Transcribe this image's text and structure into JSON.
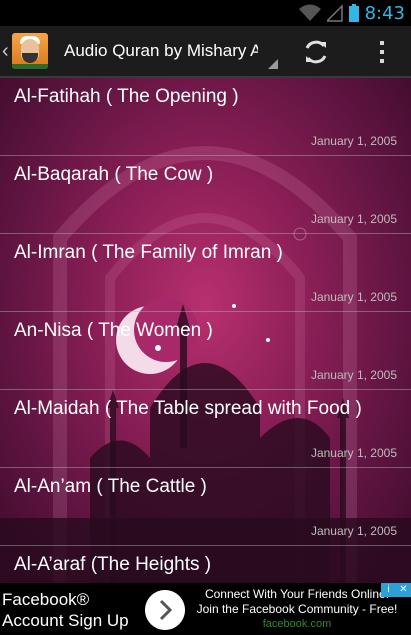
{
  "status_bar": {
    "time": "8:43"
  },
  "action_bar": {
    "up_glyph": "‹",
    "title": "Audio Quran by Mishary Alafasy",
    "refresh_icon": "refresh-icon",
    "overflow_icon": "overflow-menu-icon"
  },
  "surahs": [
    {
      "title": "Al-Fatihah ( The Opening )",
      "date": "January 1, 2005"
    },
    {
      "title": "Al-Baqarah ( The Cow )",
      "date": "January 1, 2005"
    },
    {
      "title": "Al-Imran ( The Family of Imran )",
      "date": "January 1, 2005"
    },
    {
      "title": "An-Nisa ( The Women )",
      "date": "January 1, 2005"
    },
    {
      "title": "Al-Maidah ( The Table spread with Food )",
      "date": "January 1, 2005"
    },
    {
      "title": "Al-An’am ( The Cattle )",
      "date": "January 1, 2005"
    },
    {
      "title": "Al-A’araf (The Heights )",
      "date": ""
    }
  ],
  "ad": {
    "brand_line1": "Facebook®",
    "brand_line2": "Account Sign Up",
    "text_line1": "Connect With Your Friends Online!",
    "text_line2": "Join the Facebook Community - Free!",
    "url": "facebook.com"
  },
  "colors": {
    "accent": "#33b5e5",
    "ad_link": "#2e8b2e",
    "background": "#8c1f57"
  }
}
